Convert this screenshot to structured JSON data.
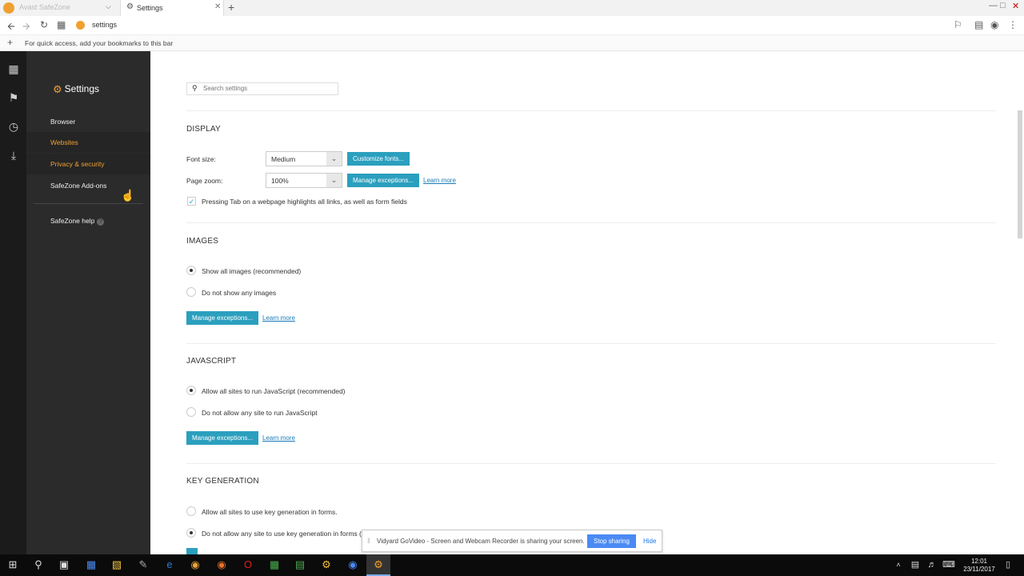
{
  "tabs": [
    {
      "title": "Avast SafeZone"
    },
    {
      "title": "Settings"
    }
  ],
  "address": {
    "url": "settings"
  },
  "bookmarks_bar": {
    "hint": "For quick access, add your bookmarks to this bar"
  },
  "sidebar": {
    "title": "Settings",
    "items": [
      {
        "label": "Browser"
      },
      {
        "label": "Websites"
      },
      {
        "label": "Privacy & security"
      },
      {
        "label": "SafeZone Add-ons"
      }
    ],
    "help_label": "SafeZone help"
  },
  "search": {
    "placeholder": "Search settings"
  },
  "display": {
    "title": "DISPLAY",
    "font_size_label": "Font size:",
    "font_size_value": "Medium",
    "customize_fonts": "Customize fonts...",
    "page_zoom_label": "Page zoom:",
    "page_zoom_value": "100%",
    "manage_exceptions": "Manage exceptions...",
    "learn_more": "Learn more",
    "tab_highlight": "Pressing Tab on a webpage highlights all links, as well as form fields"
  },
  "images": {
    "title": "IMAGES",
    "show_all": "Show all images (recommended)",
    "do_not_show": "Do not show any images",
    "manage_exceptions": "Manage exceptions...",
    "learn_more": "Learn more"
  },
  "javascript": {
    "title": "JAVASCRIPT",
    "allow_all": "Allow all sites to run JavaScript (recommended)",
    "do_not_allow": "Do not allow any site to run JavaScript",
    "manage_exceptions": "Manage exceptions...",
    "learn_more": "Learn more"
  },
  "key_generation": {
    "title": "KEY GENERATION",
    "allow_all": "Allow all sites to use key generation in forms.",
    "do_not_allow": "Do not allow any site to use key generation in forms (recommended)"
  },
  "share_banner": {
    "text": "Vidyard GoVideo - Screen and Webcam Recorder is sharing your screen.",
    "stop": "Stop sharing",
    "hide": "Hide"
  },
  "taskbar": {
    "time": "12:01",
    "date": "23/11/2017"
  },
  "colors": {
    "accent": "#2b9fbe",
    "brand": "#f0a030",
    "sidebar_bg": "#2b2b2b"
  }
}
